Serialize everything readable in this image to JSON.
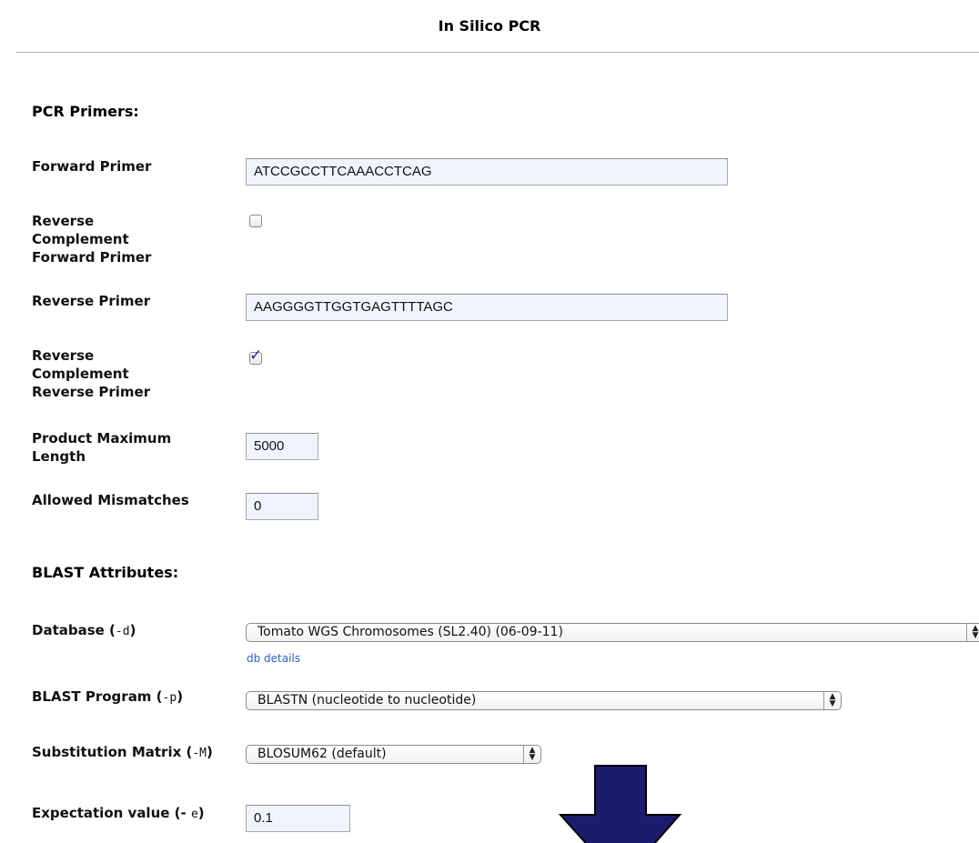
{
  "page": {
    "title": "In Silico PCR"
  },
  "pcr": {
    "section_title": "PCR Primers:",
    "forward_label": "Forward Primer",
    "forward_value": "ATCCGCCTTCAAACCTCAG",
    "rc_forward_label": "Reverse Complement Forward Primer",
    "rc_forward_checked": false,
    "reverse_label": "Reverse Primer",
    "reverse_value": "AAGGGGTTGGTGAGTTTTAGC",
    "rc_reverse_label": "Reverse Complement Reverse Primer",
    "rc_reverse_checked": true,
    "max_length_label": "Product Maximum Length",
    "max_length_value": "5000",
    "mismatches_label": "Allowed Mismatches",
    "mismatches_value": "0"
  },
  "blast": {
    "section_title": "BLAST Attributes:",
    "database_label": "Database (",
    "database_flag": "-d",
    "database_value": "Tomato WGS Chromosomes (SL2.40)  (06-09-11)",
    "db_details_link": "db details",
    "program_label": "BLAST Program (",
    "program_flag": "-p",
    "program_value": "BLASTN (nucleotide to nucleotide)",
    "matrix_label": "Substitution Matrix (",
    "matrix_flag": "-M",
    "matrix_value": "BLOSUM62 (default)",
    "evalue_label": "Expectation value (-",
    "evalue_flag": "e",
    "evalue_value": "0.1"
  },
  "colors": {
    "link": "#2d5fd2",
    "input_bg": "#f1f4ff",
    "arrow_fill": "#1c1c6e",
    "check": "#1a2e9a"
  },
  "icons": {
    "select_arrows": "updown-chevrons-icon",
    "arrow": "down-arrow-icon"
  }
}
